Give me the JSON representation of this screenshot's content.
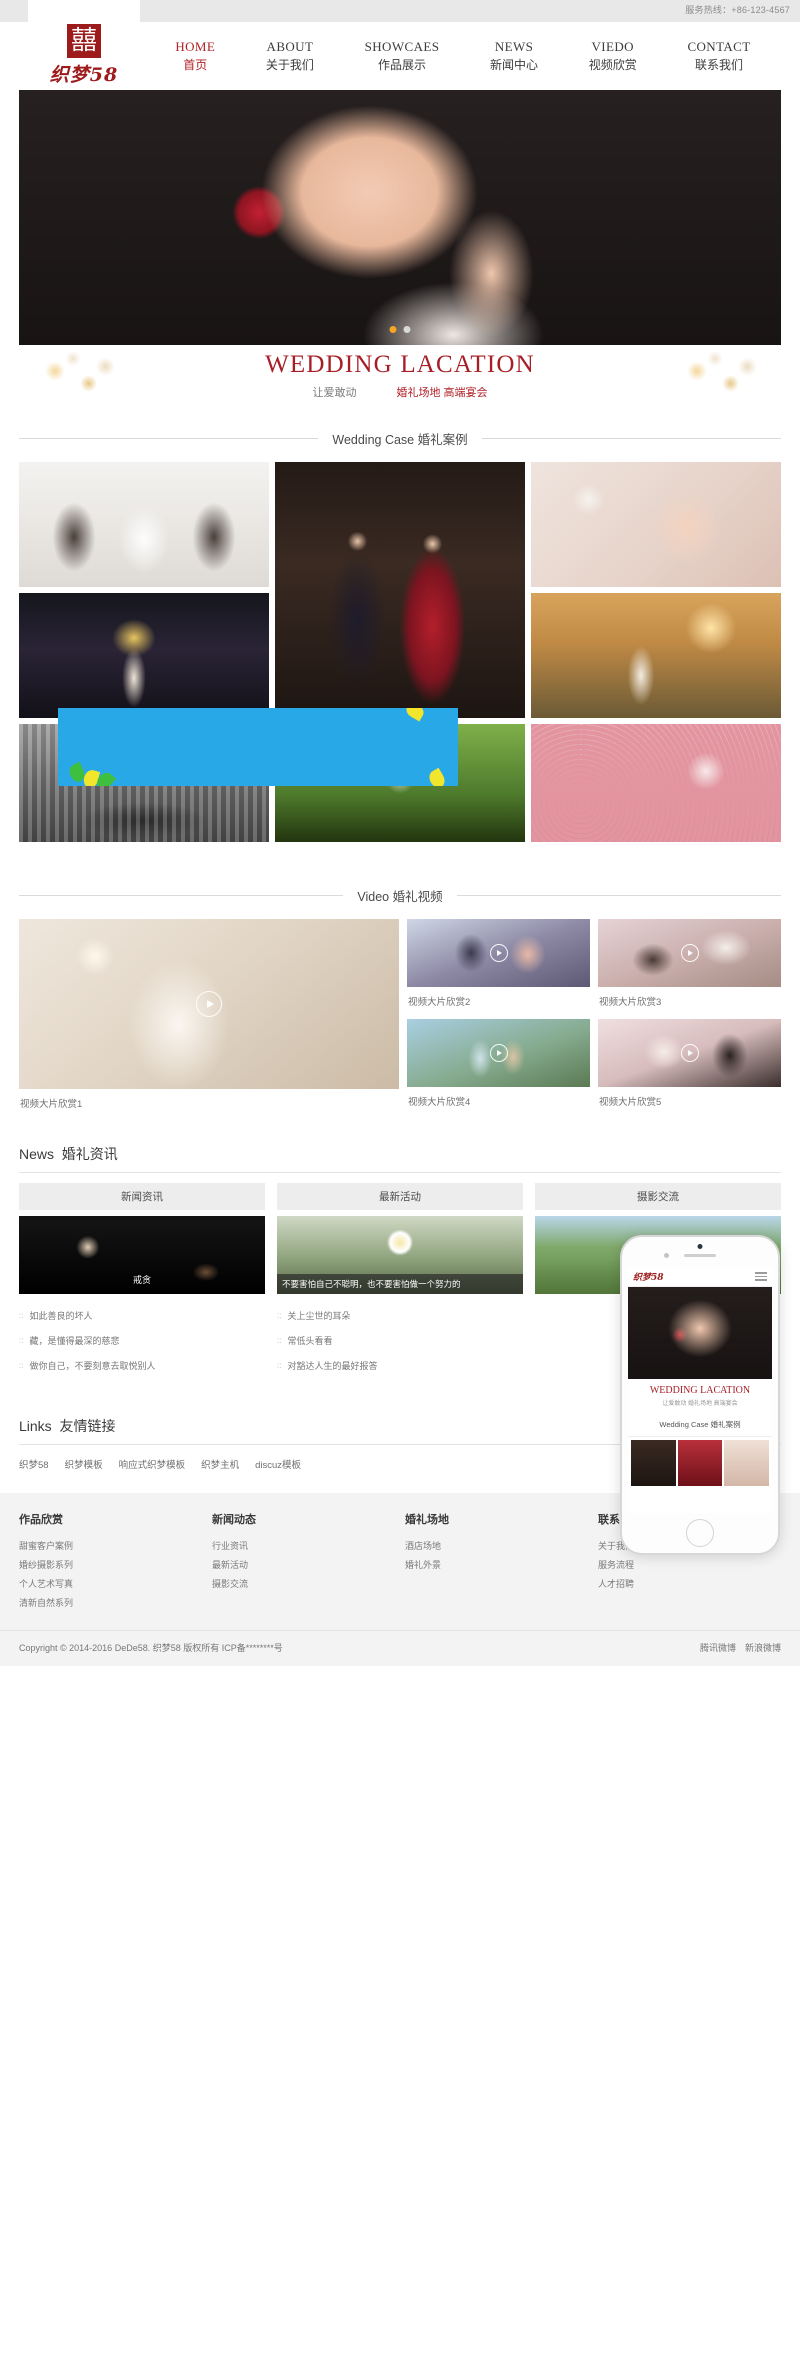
{
  "topbar": {
    "hotline": "服务热线：+86-123-4567"
  },
  "brand": {
    "mark": "囍",
    "name": "织梦58"
  },
  "nav": [
    {
      "en": "HOME",
      "cn": "首页",
      "active": true
    },
    {
      "en": "ABOUT",
      "cn": "关于我们",
      "active": false
    },
    {
      "en": "SHOWCAES",
      "cn": "作品展示",
      "active": false
    },
    {
      "en": "NEWS",
      "cn": "新闻中心",
      "active": false
    },
    {
      "en": "VIEDO",
      "cn": "视频欣赏",
      "active": false
    },
    {
      "en": "CONTACT",
      "cn": "联系我们",
      "active": false
    }
  ],
  "hero": {
    "title": "WEDDING LACATION",
    "sub_left": "让爱敢动",
    "sub_right": "婚礼场地 高端宴会",
    "dots": 2,
    "active_dot": 0
  },
  "sections": {
    "case_title": "Wedding Case 婚礼案例",
    "video_title": "Video  婚礼视频",
    "news_title_en": "News",
    "news_title_cn": "婚礼资讯",
    "links_title_en": "Links",
    "links_title_cn": "友情链接"
  },
  "videos": {
    "featured": {
      "caption": "视频大片欣赏1"
    },
    "items": [
      {
        "caption": "视频大片欣赏2"
      },
      {
        "caption": "视频大片欣赏3"
      },
      {
        "caption": "视频大片欣赏4"
      },
      {
        "caption": "视频大片欣赏5"
      }
    ]
  },
  "news": {
    "columns": [
      {
        "tab": "新闻资讯",
        "overlay": "戒贪",
        "items": [
          "如此善良的坏人",
          "藏，是懂得最深的慈悲",
          "做你自己，不要刻意去取悦别人"
        ]
      },
      {
        "tab": "最新活动",
        "overlay": "不要害怕自己不聪明，也不要害怕做一个努力的",
        "items": [
          "关上尘世的耳朵",
          "常低头看看",
          "对豁达人生的最好报答"
        ]
      },
      {
        "tab": "摄影交流",
        "overlay": "",
        "items": []
      }
    ]
  },
  "links": [
    "织梦58",
    "织梦模板",
    "响应式织梦模板",
    "织梦主机",
    "discuz模板"
  ],
  "footer": {
    "columns": [
      {
        "title": "作品欣赏",
        "items": [
          "甜蜜客户案例",
          "婚纱摄影系列",
          "个人艺术写真",
          "清新自然系列"
        ]
      },
      {
        "title": "新闻动态",
        "items": [
          "行业资讯",
          "最新活动",
          "摄影交流"
        ]
      },
      {
        "title": "婚礼场地",
        "items": [
          "酒店场地",
          "婚礼外景"
        ]
      },
      {
        "title": "联系我们",
        "items": [
          "关于我们",
          "服务流程",
          "人才招聘"
        ]
      }
    ],
    "copyright": "Copyright © 2014-2016 DeDe58. 织梦58 版权所有 ICP备********号",
    "social": [
      "腾讯微博",
      "新浪微博"
    ]
  },
  "phone": {
    "logo": "织梦58",
    "hero_title": "WEDDING LACATION",
    "hero_sub": "让爱敢动    婚礼场地 高端宴会",
    "section": "Wedding Case 婚礼案例"
  },
  "colors": {
    "brand_red": "#9e1b1b",
    "accent_red": "#b32025",
    "blue_panel": "#29a8e8"
  }
}
